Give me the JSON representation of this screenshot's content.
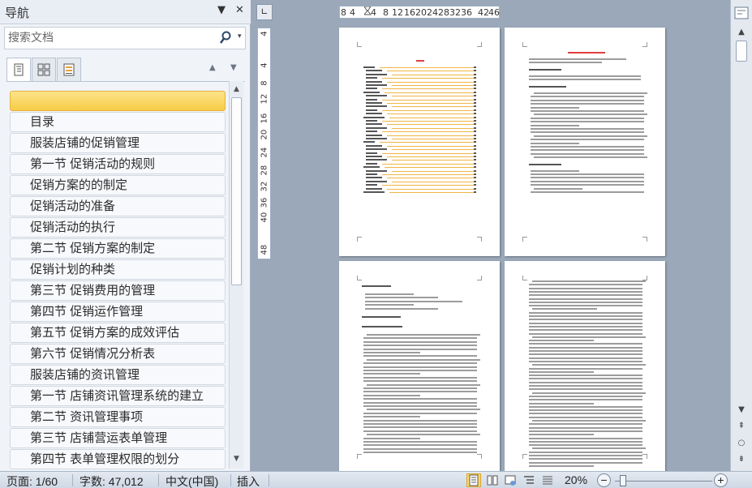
{
  "nav": {
    "title": "导航",
    "dropdown_glyph": "▼",
    "close_glyph": "✕",
    "search_placeholder": "搜索文档",
    "search_dropdown_glyph": "▾",
    "prev_glyph": "▲",
    "next_glyph": "▼",
    "items": [
      {
        "label": "",
        "selected": true
      },
      {
        "label": "目录"
      },
      {
        "label": "服装店铺的促销管理"
      },
      {
        "label": "第一节  促销活动的规则"
      },
      {
        "label": "促销方案的的制定"
      },
      {
        "label": "促销活动的准备"
      },
      {
        "label": "促销活动的执行"
      },
      {
        "label": "第二节   促销方案的制定"
      },
      {
        "label": "促销计划的种类"
      },
      {
        "label": "第三节   促销费用的管理"
      },
      {
        "label": "第四节  促销运作管理"
      },
      {
        "label": "第五节  促销方案的成效评估"
      },
      {
        "label": "第六节  促销情况分析表"
      },
      {
        "label": "服装店铺的资讯管理"
      },
      {
        "label": "第一节   店铺资讯管理系统的建立"
      },
      {
        "label": "第二节  资讯管理事项"
      },
      {
        "label": "第三节  店铺营运表单管理"
      },
      {
        "label": "第四节  表单管理权限的划分"
      }
    ]
  },
  "ruler": {
    "corner_glyph": "∟",
    "horizontal_ticks": [
      "8",
      "4",
      "4",
      "8",
      "12",
      "16",
      "20",
      "24",
      "28",
      "32",
      "36",
      "42",
      "46"
    ],
    "vertical_ticks": [
      "4",
      "4",
      "8",
      "12",
      "16",
      "20",
      "24",
      "28",
      "32",
      "36",
      "40",
      "48"
    ]
  },
  "status": {
    "page": "页面: 1/60",
    "words": "字数: 47,012",
    "language": "中文(中国)",
    "mode": "插入",
    "zoom": "20%",
    "zoom_minus": "−",
    "zoom_plus": "+"
  },
  "scrollbar": {
    "up": "▲",
    "down": "▼",
    "prev_page": "⇞",
    "select_browse": "○",
    "next_page": "⇟"
  },
  "colors": {
    "selected_item": "#fbd762",
    "toc_title": "#e23d3d",
    "toc_leader": "#f0b545"
  }
}
